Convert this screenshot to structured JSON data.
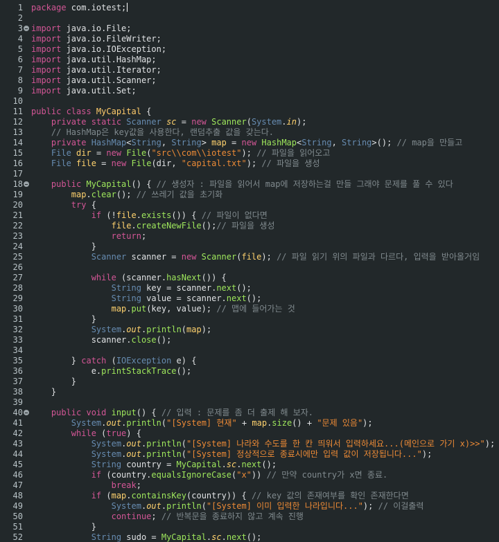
{
  "editor": {
    "file_content": [
      {
        "n": "1",
        "t": [
          [
            "k",
            "package"
          ],
          [
            "n",
            " com.iotest;"
          ]
        ],
        "caret": true
      },
      {
        "n": "2",
        "t": []
      },
      {
        "n": "3",
        "fold": true,
        "t": [
          [
            "k",
            "import"
          ],
          [
            "n",
            " java.io.File;"
          ]
        ]
      },
      {
        "n": "4",
        "t": [
          [
            "k",
            "import"
          ],
          [
            "n",
            " java.io.FileWriter;"
          ]
        ]
      },
      {
        "n": "5",
        "t": [
          [
            "k",
            "import"
          ],
          [
            "n",
            " java.io.IOException;"
          ]
        ]
      },
      {
        "n": "6",
        "t": [
          [
            "k",
            "import"
          ],
          [
            "n",
            " java.util.HashMap;"
          ]
        ]
      },
      {
        "n": "7",
        "t": [
          [
            "k",
            "import"
          ],
          [
            "n",
            " java.util.Iterator;"
          ]
        ]
      },
      {
        "n": "8",
        "t": [
          [
            "k",
            "import"
          ],
          [
            "n",
            " java.util.Scanner;"
          ]
        ]
      },
      {
        "n": "9",
        "t": [
          [
            "k",
            "import"
          ],
          [
            "n",
            " java.util.Set;"
          ]
        ]
      },
      {
        "n": "10",
        "t": []
      },
      {
        "n": "11",
        "t": [
          [
            "k",
            "public class "
          ],
          [
            "cc",
            "MyCapital"
          ],
          [
            "n",
            " {"
          ]
        ]
      },
      {
        "n": "12",
        "t": [
          [
            "n",
            "    "
          ],
          [
            "k",
            "private static "
          ],
          [
            "t",
            "Scanner "
          ],
          [
            "i",
            "sc"
          ],
          [
            "n",
            " = "
          ],
          [
            "k",
            "new "
          ],
          [
            "f",
            "Scanner"
          ],
          [
            "n",
            "("
          ],
          [
            "t",
            "System"
          ],
          [
            "n",
            "."
          ],
          [
            "i",
            "in"
          ],
          [
            "n",
            ");"
          ]
        ]
      },
      {
        "n": "13",
        "t": [
          [
            "c",
            "    // HashMap은 key값을 사용한다, 랜덤추출 값을 갖는다."
          ]
        ]
      },
      {
        "n": "14",
        "t": [
          [
            "n",
            "    "
          ],
          [
            "k",
            "private "
          ],
          [
            "t",
            "HashMap"
          ],
          [
            "n",
            "<"
          ],
          [
            "t",
            "String"
          ],
          [
            "n",
            ", "
          ],
          [
            "t",
            "String"
          ],
          [
            "n",
            "> "
          ],
          [
            "v",
            "map"
          ],
          [
            "n",
            " = "
          ],
          [
            "k",
            "new "
          ],
          [
            "f",
            "HashMap"
          ],
          [
            "n",
            "<"
          ],
          [
            "t",
            "String"
          ],
          [
            "n",
            ", "
          ],
          [
            "t",
            "String"
          ],
          [
            "n",
            ">(); "
          ],
          [
            "c",
            "// map을 만들고"
          ]
        ]
      },
      {
        "n": "15",
        "t": [
          [
            "n",
            "    "
          ],
          [
            "t",
            "File "
          ],
          [
            "v",
            "dir"
          ],
          [
            "n",
            " = "
          ],
          [
            "k",
            "new "
          ],
          [
            "f",
            "File"
          ],
          [
            "n",
            "("
          ],
          [
            "s",
            "\"src\\\\com\\\\iotest\""
          ],
          [
            "n",
            "); "
          ],
          [
            "c",
            "// 파일을 읽어오고"
          ]
        ]
      },
      {
        "n": "16",
        "t": [
          [
            "n",
            "    "
          ],
          [
            "t",
            "File "
          ],
          [
            "v",
            "file"
          ],
          [
            "n",
            " = "
          ],
          [
            "k",
            "new "
          ],
          [
            "f",
            "File"
          ],
          [
            "n",
            "(dir, "
          ],
          [
            "s",
            "\"capital.txt\""
          ],
          [
            "n",
            "); "
          ],
          [
            "c",
            "// 파일을 생성"
          ]
        ]
      },
      {
        "n": "17",
        "t": []
      },
      {
        "n": "18",
        "fold": true,
        "t": [
          [
            "n",
            "    "
          ],
          [
            "k",
            "public "
          ],
          [
            "f",
            "MyCapital"
          ],
          [
            "n",
            "() { "
          ],
          [
            "c",
            "// 생성자 : 파일을 읽어서 map에 저장하는걸 만들 그래야 문제를 풀 수 있다"
          ]
        ]
      },
      {
        "n": "19",
        "t": [
          [
            "n",
            "        "
          ],
          [
            "v",
            "map"
          ],
          [
            "n",
            "."
          ],
          [
            "f",
            "clear"
          ],
          [
            "n",
            "(); "
          ],
          [
            "c",
            "// 쓰레기 값을 초기화"
          ]
        ]
      },
      {
        "n": "20",
        "t": [
          [
            "n",
            "        "
          ],
          [
            "k",
            "try"
          ],
          [
            "n",
            " {"
          ]
        ]
      },
      {
        "n": "21",
        "t": [
          [
            "n",
            "            "
          ],
          [
            "k",
            "if"
          ],
          [
            "n",
            " (!"
          ],
          [
            "v",
            "file"
          ],
          [
            "n",
            "."
          ],
          [
            "f",
            "exists"
          ],
          [
            "n",
            "()) { "
          ],
          [
            "c",
            "// 파일이 없다면"
          ]
        ]
      },
      {
        "n": "22",
        "t": [
          [
            "n",
            "                "
          ],
          [
            "v",
            "file"
          ],
          [
            "n",
            "."
          ],
          [
            "f",
            "createNewFile"
          ],
          [
            "n",
            "();"
          ],
          [
            "c",
            "// 파일을 생성"
          ]
        ]
      },
      {
        "n": "23",
        "t": [
          [
            "n",
            "                "
          ],
          [
            "k",
            "return"
          ],
          [
            "n",
            ";"
          ]
        ]
      },
      {
        "n": "24",
        "t": [
          [
            "n",
            "            }"
          ]
        ]
      },
      {
        "n": "25",
        "t": [
          [
            "n",
            "            "
          ],
          [
            "t",
            "Scanner "
          ],
          [
            "n",
            "scanner = "
          ],
          [
            "k",
            "new "
          ],
          [
            "f",
            "Scanner"
          ],
          [
            "n",
            "("
          ],
          [
            "v",
            "file"
          ],
          [
            "n",
            "); "
          ],
          [
            "c",
            "// 파일 읽기 위의 파일과 다르다, 입력을 받아올거임"
          ]
        ]
      },
      {
        "n": "26",
        "t": []
      },
      {
        "n": "27",
        "t": [
          [
            "n",
            "            "
          ],
          [
            "k",
            "while"
          ],
          [
            "n",
            " (scanner."
          ],
          [
            "f",
            "hasNext"
          ],
          [
            "n",
            "()) {"
          ]
        ]
      },
      {
        "n": "28",
        "t": [
          [
            "n",
            "                "
          ],
          [
            "t",
            "String "
          ],
          [
            "n",
            "key = scanner."
          ],
          [
            "f",
            "next"
          ],
          [
            "n",
            "();"
          ]
        ]
      },
      {
        "n": "29",
        "t": [
          [
            "n",
            "                "
          ],
          [
            "t",
            "String "
          ],
          [
            "n",
            "value = scanner."
          ],
          [
            "f",
            "next"
          ],
          [
            "n",
            "();"
          ]
        ]
      },
      {
        "n": "30",
        "t": [
          [
            "n",
            "                "
          ],
          [
            "v",
            "map"
          ],
          [
            "n",
            "."
          ],
          [
            "f",
            "put"
          ],
          [
            "n",
            "(key, value); "
          ],
          [
            "c",
            "// 맵에 들어가는 것"
          ]
        ]
      },
      {
        "n": "31",
        "t": [
          [
            "n",
            "            }"
          ]
        ]
      },
      {
        "n": "32",
        "t": [
          [
            "n",
            "            "
          ],
          [
            "t",
            "System"
          ],
          [
            "n",
            "."
          ],
          [
            "i",
            "out"
          ],
          [
            "n",
            "."
          ],
          [
            "f",
            "println"
          ],
          [
            "n",
            "("
          ],
          [
            "v",
            "map"
          ],
          [
            "n",
            ");"
          ]
        ]
      },
      {
        "n": "33",
        "t": [
          [
            "n",
            "            scanner."
          ],
          [
            "f",
            "close"
          ],
          [
            "n",
            "();"
          ]
        ]
      },
      {
        "n": "34",
        "t": []
      },
      {
        "n": "35",
        "t": [
          [
            "n",
            "        } "
          ],
          [
            "k",
            "catch"
          ],
          [
            "n",
            " ("
          ],
          [
            "t",
            "IOException"
          ],
          [
            "n",
            " e) {"
          ]
        ]
      },
      {
        "n": "36",
        "t": [
          [
            "n",
            "            e."
          ],
          [
            "f",
            "printStackTrace"
          ],
          [
            "n",
            "();"
          ]
        ]
      },
      {
        "n": "37",
        "t": [
          [
            "n",
            "        }"
          ]
        ]
      },
      {
        "n": "38",
        "t": [
          [
            "n",
            "    }"
          ]
        ]
      },
      {
        "n": "39",
        "t": []
      },
      {
        "n": "40",
        "fold": true,
        "t": [
          [
            "n",
            "    "
          ],
          [
            "k",
            "public void "
          ],
          [
            "f",
            "input"
          ],
          [
            "n",
            "() { "
          ],
          [
            "c",
            "// 입력 : 문제를 좀 더 출제 해 보자."
          ]
        ]
      },
      {
        "n": "41",
        "t": [
          [
            "n",
            "        "
          ],
          [
            "t",
            "System"
          ],
          [
            "n",
            "."
          ],
          [
            "i",
            "out"
          ],
          [
            "n",
            "."
          ],
          [
            "f",
            "println"
          ],
          [
            "n",
            "("
          ],
          [
            "s",
            "\"[System] 현재\""
          ],
          [
            "n",
            " + "
          ],
          [
            "v",
            "map"
          ],
          [
            "n",
            "."
          ],
          [
            "f",
            "size"
          ],
          [
            "n",
            "() + "
          ],
          [
            "s",
            "\"문제 있음\""
          ],
          [
            "n",
            ");"
          ]
        ]
      },
      {
        "n": "42",
        "t": [
          [
            "n",
            "        "
          ],
          [
            "k",
            "while"
          ],
          [
            "n",
            " ("
          ],
          [
            "k",
            "true"
          ],
          [
            "n",
            ") {"
          ]
        ]
      },
      {
        "n": "43",
        "t": [
          [
            "n",
            "            "
          ],
          [
            "t",
            "System"
          ],
          [
            "n",
            "."
          ],
          [
            "i",
            "out"
          ],
          [
            "n",
            "."
          ],
          [
            "f",
            "println"
          ],
          [
            "n",
            "("
          ],
          [
            "s",
            "\"[System] 나라와 수도를 한 칸 띄워서 입력하세요...(메인으로 가기 x)>>\""
          ],
          [
            "n",
            ");"
          ]
        ]
      },
      {
        "n": "44",
        "t": [
          [
            "n",
            "            "
          ],
          [
            "t",
            "System"
          ],
          [
            "n",
            "."
          ],
          [
            "i",
            "out"
          ],
          [
            "n",
            "."
          ],
          [
            "f",
            "println"
          ],
          [
            "n",
            "("
          ],
          [
            "s",
            "\"[System] 정상적으로 종료시에만 입력 값이 저장됩니다...\""
          ],
          [
            "n",
            ");"
          ]
        ]
      },
      {
        "n": "45",
        "t": [
          [
            "n",
            "            "
          ],
          [
            "t",
            "String "
          ],
          [
            "n",
            "country = "
          ],
          [
            "f",
            "MyCapital"
          ],
          [
            "n",
            "."
          ],
          [
            "i",
            "sc"
          ],
          [
            "n",
            "."
          ],
          [
            "f",
            "next"
          ],
          [
            "n",
            "();"
          ]
        ]
      },
      {
        "n": "46",
        "t": [
          [
            "n",
            "            "
          ],
          [
            "k",
            "if"
          ],
          [
            "n",
            " (country."
          ],
          [
            "f",
            "equalsIgnoreCase"
          ],
          [
            "n",
            "("
          ],
          [
            "s",
            "\"x\""
          ],
          [
            "n",
            ")) "
          ],
          [
            "c",
            "// 만약 country가 x면 종료."
          ]
        ]
      },
      {
        "n": "47",
        "t": [
          [
            "n",
            "                "
          ],
          [
            "k",
            "break"
          ],
          [
            "n",
            ";"
          ]
        ]
      },
      {
        "n": "48",
        "t": [
          [
            "n",
            "            "
          ],
          [
            "k",
            "if"
          ],
          [
            "n",
            " ("
          ],
          [
            "v",
            "map"
          ],
          [
            "n",
            "."
          ],
          [
            "f",
            "containsKey"
          ],
          [
            "n",
            "(country)) { "
          ],
          [
            "c",
            "// key 값의 존재여부를 확인 존재한다면"
          ]
        ]
      },
      {
        "n": "49",
        "t": [
          [
            "n",
            "                "
          ],
          [
            "t",
            "System"
          ],
          [
            "n",
            "."
          ],
          [
            "i",
            "out"
          ],
          [
            "n",
            "."
          ],
          [
            "f",
            "println"
          ],
          [
            "n",
            "("
          ],
          [
            "s",
            "\"[System] 이미 입력한 나라입니다...\""
          ],
          [
            "n",
            "); "
          ],
          [
            "c",
            "// 이걸출력"
          ]
        ]
      },
      {
        "n": "50",
        "t": [
          [
            "n",
            "                "
          ],
          [
            "k",
            "continue"
          ],
          [
            "n",
            "; "
          ],
          [
            "c",
            "// 반복문을 종료하지 않고 계속 진행"
          ]
        ]
      },
      {
        "n": "51",
        "t": [
          [
            "n",
            "            }"
          ]
        ]
      },
      {
        "n": "52",
        "t": [
          [
            "n",
            "            "
          ],
          [
            "t",
            "String "
          ],
          [
            "n",
            "sudo = "
          ],
          [
            "f",
            "MyCapital"
          ],
          [
            "n",
            "."
          ],
          [
            "i",
            "sc"
          ],
          [
            "n",
            "."
          ],
          [
            "f",
            "next"
          ],
          [
            "n",
            "();"
          ]
        ]
      }
    ]
  },
  "colors": {
    "background": "#22282a",
    "keyword": "#d35696",
    "type": "#678cb1",
    "field": "#ffd26e",
    "method": "#9fe85c",
    "string": "#ec8a36",
    "comment": "#808a8e",
    "text": "#e0e2e4",
    "line_number": "#b7c1c5"
  }
}
